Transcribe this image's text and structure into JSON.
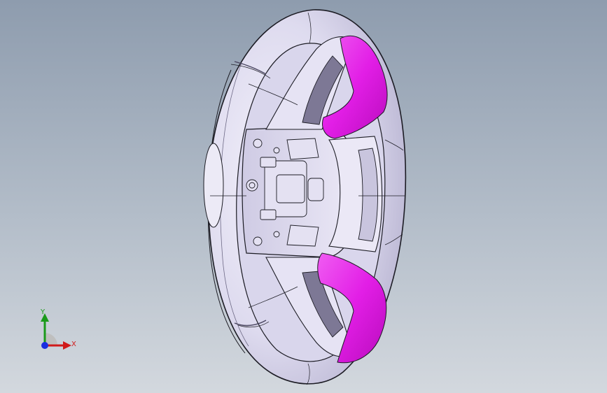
{
  "viewport": {
    "background_top": "#8e9cae",
    "background_bottom": "#d3d8de"
  },
  "model": {
    "part": "steering-wheel",
    "body_color": "#e6e3f4",
    "edge_color": "#1c1c24",
    "highlight_color": "#e21ee6",
    "highlighted_faces": [
      "upper-spoke",
      "lower-spoke"
    ]
  },
  "triad": {
    "x_label": "X",
    "y_label": "Y",
    "x_color": "#d01a1a",
    "y_color": "#1a9a1a",
    "z_color": "#1a2ee0"
  }
}
